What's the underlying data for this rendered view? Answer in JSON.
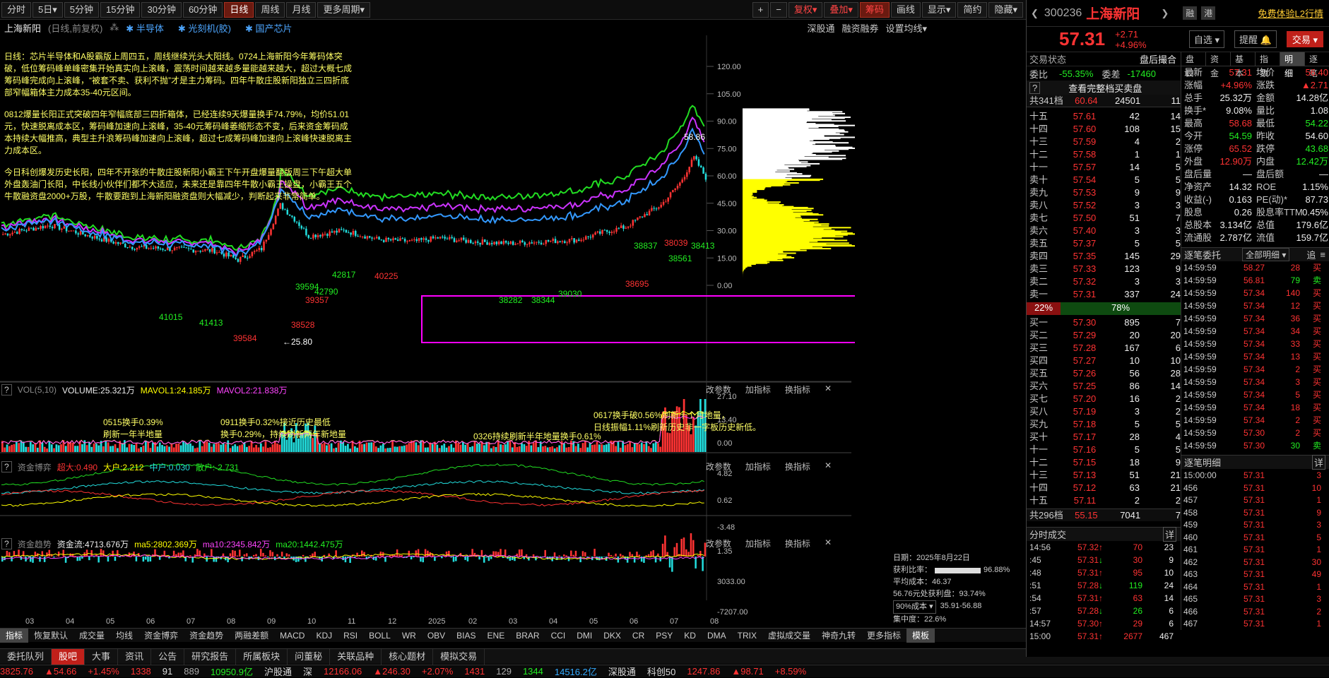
{
  "toolbar": {
    "items": [
      "分时",
      "5日▾",
      "5分钟",
      "15分钟",
      "30分钟",
      "60分钟",
      "日线",
      "周线",
      "月线",
      "更多周期▾"
    ],
    "active": "日线",
    "right": [
      "+",
      "−",
      "复权▾",
      "叠加▾",
      "筹码",
      "画线",
      "显示▾",
      "简约",
      "隐藏▾"
    ]
  },
  "chartbar": {
    "name": "上海新阳",
    "mode": "(日线,前复权)",
    "tags": [
      "半导体",
      "光刻机(胶)",
      "国产芯片"
    ],
    "right": [
      "深股通",
      "融资融券",
      "设置均线▾"
    ]
  },
  "annotation": {
    "p1": "日线：芯片半导体和A股霸版上周四五，周线继续光头大阳线。0724上海新阳今年筹码体突破，低位筹码峰单峰密集开始真实向上滚峰，震荡时间越来越多量能越来越大，超过大概七成筹码峰完成向上滚峰，“被套不卖、获利不抛”才是主力筹码。四年牛散庄股新阳独立三四折底部窄幅箱体主力成本35-40元区间。",
    "p2": "0812爆量长阳正式突破四年窄幅底部三四折箱体，已经连续9天爆量换手74.79%，均价51.01元，快速脱离成本区，筹码峰加速向上滚峰，35-40元筹码峰萎缩形态不变，后来资金筹码成本持续大幅推高，典型主升浪筹码峰加速向上滚峰，超过七成筹码峰加速向上滚峰快速脱离主力成本区。",
    "p3": "今日科创爆发历史长阳，四年不开张的牛散庄股新阳小霸王下午开盘爆量翻版周三下午超大单外盘轰油门长阳，中长线小伙伴们都不大适应，未来还是靠四年牛散小霸王操盘，小霸王五个牛散融资盘2000+万股，牛散要跑到上海新阳融资盘则大幅减少，判断起来非常简单。"
  },
  "price_labels": [
    "120.00",
    "105.00",
    "90.00",
    "75.00",
    "60.00",
    "45.00",
    "30.00",
    "15.00",
    "0.00"
  ],
  "chip_info": {
    "date": "日期：2025年8月22日",
    "win_label": "获利比率：",
    "win_val": "96.88%",
    "avg": "平均成本：46.37",
    "profit": "56.76元处获利盘：93.74%",
    "range_sel": "90%成本 ▾",
    "range": "35.91-56.88",
    "conc": "集中度：22.6%"
  },
  "chart_marks": [
    "58.86",
    "←25.80",
    "42817",
    "42790",
    "39357",
    "39594",
    "40225",
    "41015",
    "41413",
    "39584",
    "38528",
    "38837",
    "38039",
    "38413",
    "38561",
    "38695",
    "38282",
    "38344",
    "39030"
  ],
  "vol": {
    "hdr": [
      "VOL(5,10)",
      "VOLUME:25.321万",
      "MAVOL1:24.185万",
      "MAVOL2:21.838万"
    ],
    "scale": [
      "27.10",
      "13.40",
      "0.00"
    ],
    "notes": [
      "0515换手0.39%\n刷新一年半地量",
      "0911换手0.32%接近历史最低\n换手0.29%，持续刷新两年新地量",
      "0326持续刷新半年地量换手0.61%",
      "0617换手破0.56%刷新十个月地量，\n日线振幅1.11%刷新历史非一字板历史新低。"
    ]
  },
  "zjbh": {
    "hdr": [
      "资金博弈",
      "超大:0.490",
      "大户:2.212",
      "中户:0.030",
      "散户:-2.731"
    ],
    "scale": [
      "4.82",
      "0.62",
      "-3.48"
    ]
  },
  "zjqs": {
    "hdr": [
      "资金趋势",
      "资金流:4713.676万",
      "ma5:2802.369万",
      "ma10:2345.842万",
      "ma20:1442.475万"
    ],
    "scale": [
      "1.35",
      "3033.00",
      "-7207.00"
    ]
  },
  "panel_btns": [
    "改参数",
    "加指标",
    "换指标"
  ],
  "xaxis": [
    "03",
    "04",
    "05",
    "06",
    "07",
    "08",
    "09",
    "10",
    "11",
    "12",
    "2025",
    "02",
    "03",
    "04",
    "05",
    "06",
    "07",
    "08"
  ],
  "ind_tabs": [
    "指标",
    "恢复默认",
    "成交量",
    "均线",
    "资金博弈",
    "资金趋势",
    "两融差额",
    "MACD",
    "KDJ",
    "RSI",
    "BOLL",
    "WR",
    "OBV",
    "BIAS",
    "ENE",
    "BRAR",
    "CCI",
    "DMI",
    "DKX",
    "CR",
    "PSY",
    "KD",
    "DMA",
    "TRIX",
    "虚拟成交量",
    "神奇九转",
    "更多指标",
    "模板"
  ],
  "bottom_tabs": [
    "委托队列",
    "股吧",
    "大事",
    "资讯",
    "公告",
    "研究报告",
    "所属板块",
    "问董秘",
    "关联品种",
    "核心题材",
    "模拟交易"
  ],
  "status": [
    "3825.76",
    "▲54.66",
    "+1.45%",
    "1338",
    "91",
    "889",
    "10950.9亿",
    "沪股通",
    "深",
    "12166.06",
    "▲246.30",
    "+2.07%",
    "1431",
    "129",
    "1344",
    "14516.2亿",
    "深股通",
    "科创50",
    "1247.86",
    "▲98.71",
    "+8.59%"
  ],
  "stock": {
    "code": "300236",
    "name": "上海新阳",
    "price": "57.31",
    "chg": "+2.71",
    "pct": "+4.96%",
    "btns": [
      "融",
      "港"
    ],
    "promo": "免费体验L2行情",
    "select": "自选 ▾",
    "remind": "提醒",
    "trade": "交易"
  },
  "deal_state": {
    "label": "交易状态",
    "val": "盘后撮合",
    "wb_label": "委比",
    "wb": "-55.35%",
    "wc_label": "委差",
    "wc": "-17460",
    "full": "查看完整档买卖盘",
    "ask_total": "共341档",
    "ask_px": "60.64",
    "ask_vol": "24501",
    "ask_n": "11"
  },
  "asks": [
    [
      "十五",
      "57.61",
      "42",
      "14"
    ],
    [
      "十四",
      "57.60",
      "108",
      "15"
    ],
    [
      "十三",
      "57.59",
      "4",
      "2"
    ],
    [
      "十二",
      "57.58",
      "1",
      "1"
    ],
    [
      "十一",
      "57.57",
      "14",
      "5"
    ],
    [
      "卖十",
      "57.54",
      "5",
      "5"
    ],
    [
      "卖九",
      "57.53",
      "9",
      "9"
    ],
    [
      "卖八",
      "57.52",
      "3",
      "3"
    ],
    [
      "卖七",
      "57.50",
      "51",
      "7"
    ],
    [
      "卖六",
      "57.40",
      "3",
      "3"
    ],
    [
      "卖五",
      "57.37",
      "5",
      "5"
    ],
    [
      "卖四",
      "57.35",
      "145",
      "29"
    ],
    [
      "卖三",
      "57.33",
      "123",
      "9"
    ],
    [
      "卖二",
      "57.32",
      "3",
      "3"
    ],
    [
      "卖一",
      "57.31",
      "337",
      "24"
    ]
  ],
  "ratio": [
    "22%",
    "78%"
  ],
  "bids": [
    [
      "买一",
      "57.30",
      "895",
      "7"
    ],
    [
      "买二",
      "57.29",
      "20",
      "20"
    ],
    [
      "买三",
      "57.28",
      "167",
      "6"
    ],
    [
      "买四",
      "57.27",
      "10",
      "10"
    ],
    [
      "买五",
      "57.26",
      "56",
      "28"
    ],
    [
      "买六",
      "57.25",
      "86",
      "14"
    ],
    [
      "买七",
      "57.20",
      "16",
      "2"
    ],
    [
      "买八",
      "57.19",
      "3",
      "2"
    ],
    [
      "买九",
      "57.18",
      "5",
      "5"
    ],
    [
      "买十",
      "57.17",
      "28",
      "4"
    ],
    [
      "十一",
      "57.16",
      "5",
      "5"
    ],
    [
      "十二",
      "57.15",
      "18",
      "9"
    ],
    [
      "十三",
      "57.13",
      "51",
      "21"
    ],
    [
      "十四",
      "57.12",
      "63",
      "21"
    ],
    [
      "十五",
      "57.11",
      "2",
      "2"
    ]
  ],
  "bid_total": [
    "共296档",
    "55.15",
    "7041",
    "7"
  ],
  "fenshi": {
    "title": "分时成交",
    "more": "详",
    "rows": [
      [
        "14:56",
        "57.32",
        "70",
        "23"
      ],
      [
        ":45",
        "57.31",
        "30",
        "9"
      ],
      [
        ":48",
        "57.31",
        "95",
        "10"
      ],
      [
        ":51",
        "57.28",
        "119",
        "24"
      ],
      [
        ":54",
        "57.31",
        "63",
        "14"
      ],
      [
        ":57",
        "57.28",
        "26",
        "6"
      ],
      [
        "14:57",
        "57.30",
        "29",
        "6"
      ],
      [
        "15:00",
        "57.31",
        "2677",
        "467"
      ]
    ]
  },
  "tabs2": [
    "盘口",
    "资金",
    "基本",
    "指数",
    "明细",
    "逐笔"
  ],
  "stats": [
    [
      "最新",
      "57.31",
      "均价",
      "56.40"
    ],
    [
      "涨幅",
      "+4.96%",
      "涨跌",
      "▲2.71"
    ],
    [
      "总手",
      "25.32万",
      "金额",
      "14.28亿"
    ],
    [
      "换手*",
      "9.08%",
      "量比",
      "1.08"
    ],
    [
      "最高",
      "58.68",
      "最低",
      "54.22"
    ],
    [
      "今开",
      "54.59",
      "昨收",
      "54.60"
    ],
    [
      "涨停",
      "65.52",
      "跌停",
      "43.68"
    ],
    [
      "外盘",
      "12.90万",
      "内盘",
      "12.42万"
    ],
    [
      "盘后量",
      "—",
      "盘后额",
      "—"
    ],
    [
      "净资产",
      "14.32",
      "ROE",
      "1.15%"
    ],
    [
      "收益(-)",
      "0.163",
      "PE(动)*",
      "87.73"
    ],
    [
      "股息",
      "0.26",
      "股息率TTM",
      "0.45%"
    ],
    [
      "总股本",
      "3.134亿",
      "总值",
      "179.6亿"
    ],
    [
      "流通股",
      "2.787亿",
      "流值",
      "159.7亿"
    ]
  ],
  "zbwt": {
    "title": "逐笔委托",
    "sel": "全部明细 ▾",
    "rows": [
      [
        "14:59:59",
        "58.27",
        "28",
        "买"
      ],
      [
        "14:59:59",
        "56.81",
        "79",
        "卖"
      ],
      [
        "14:59:59",
        "57.34",
        "140",
        "买"
      ],
      [
        "14:59:59",
        "57.34",
        "12",
        "买"
      ],
      [
        "14:59:59",
        "57.34",
        "36",
        "买"
      ],
      [
        "14:59:59",
        "57.34",
        "34",
        "买"
      ],
      [
        "14:59:59",
        "57.34",
        "33",
        "买"
      ],
      [
        "14:59:59",
        "57.34",
        "13",
        "买"
      ],
      [
        "14:59:59",
        "57.34",
        "2",
        "买"
      ],
      [
        "14:59:59",
        "57.34",
        "3",
        "买"
      ],
      [
        "14:59:59",
        "57.34",
        "5",
        "买"
      ],
      [
        "14:59:59",
        "57.34",
        "18",
        "买"
      ],
      [
        "14:59:59",
        "57.34",
        "2",
        "买"
      ],
      [
        "14:59:59",
        "57.30",
        "2",
        "买"
      ],
      [
        "14:59:59",
        "57.30",
        "30",
        "卖"
      ]
    ]
  },
  "zbmx": {
    "title": "逐笔明细",
    "more": "详",
    "rows": [
      [
        "15:00:00",
        "57.31",
        "3"
      ],
      [
        "456",
        "57.31",
        "10"
      ],
      [
        "457",
        "57.31",
        "1"
      ],
      [
        "458",
        "57.31",
        "9"
      ],
      [
        "459",
        "57.31",
        "3"
      ],
      [
        "460",
        "57.31",
        "5"
      ],
      [
        "461",
        "57.31",
        "1"
      ],
      [
        "462",
        "57.31",
        "30"
      ],
      [
        "463",
        "57.31",
        "49"
      ],
      [
        "464",
        "57.31",
        "1"
      ],
      [
        "465",
        "57.31",
        "3"
      ],
      [
        "466",
        "57.31",
        "2"
      ],
      [
        "467",
        "57.31",
        "1"
      ]
    ]
  },
  "colors": {
    "up": "#ff3333",
    "down": "#22ee22",
    "magenta": "#ff00ff",
    "yellow": "#ffff00",
    "cyan": "#22dddd"
  }
}
